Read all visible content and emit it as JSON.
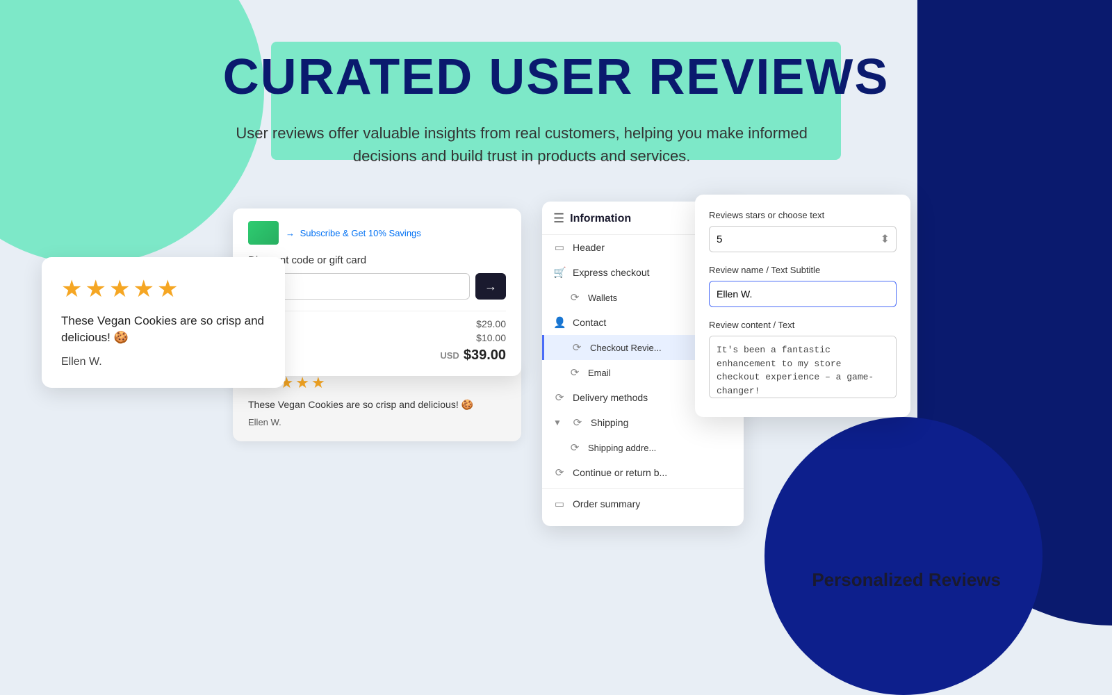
{
  "page": {
    "title": "CURATED USER REVIEWS",
    "subtitle": "User reviews offer valuable insights from real customers, helping you make informed decisions and build trust in products and services.",
    "personalized_label": "Personalized Reviews"
  },
  "checkout": {
    "subscribe_text": "Subscribe & Get 10% Savings",
    "discount_label": "Discount code or gift card",
    "discount_placeholder": "",
    "price1": "$29.00",
    "price2": "$10.00",
    "total_currency": "USD",
    "total": "$39.00"
  },
  "review_main": {
    "stars": [
      "★",
      "★",
      "★",
      "★",
      "★"
    ],
    "text": "These Vegan Cookies are so crisp and delicious! 🍪",
    "name": "Ellen W."
  },
  "review_checkout": {
    "stars": [
      "★",
      "★",
      "★",
      "★",
      "★"
    ],
    "text": "These Vegan Cookies are so crisp and delicious! 🍪",
    "name": "Ellen W."
  },
  "settings_panel": {
    "header_icon": "☰",
    "title": "Information",
    "menu": [
      {
        "id": "header",
        "icon": "▭",
        "label": "Header"
      },
      {
        "id": "express_checkout",
        "icon": "🛒",
        "label": "Express checkout"
      },
      {
        "id": "wallets",
        "icon": "⟳",
        "label": "Wallets",
        "sub": true
      },
      {
        "id": "contact",
        "icon": "👤",
        "label": "Contact"
      },
      {
        "id": "checkout_review",
        "icon": "⟳",
        "label": "Checkout Review",
        "active": true,
        "sub": true
      },
      {
        "id": "email",
        "icon": "⟳",
        "label": "Email",
        "sub": true
      },
      {
        "id": "delivery",
        "icon": "⟳",
        "label": "Delivery methods"
      },
      {
        "id": "shipping",
        "icon": "⟳",
        "label": "Shipping",
        "expandable": true
      },
      {
        "id": "shipping_address",
        "icon": "⟳",
        "label": "Shipping address",
        "sub": true
      },
      {
        "id": "continue",
        "icon": "⟳",
        "label": "Continue or return b..."
      },
      {
        "id": "order_summary",
        "icon": "▭",
        "label": "Order summary"
      }
    ]
  },
  "editor": {
    "stars_label": "Reviews stars or choose text",
    "stars_value": "5",
    "name_label": "Review name / Text Subtitle",
    "name_value": "Ellen W.",
    "content_label": "Review content / Text",
    "content_value": "It's been a fantastic enhancement to my store checkout experience – a game-changer!"
  }
}
